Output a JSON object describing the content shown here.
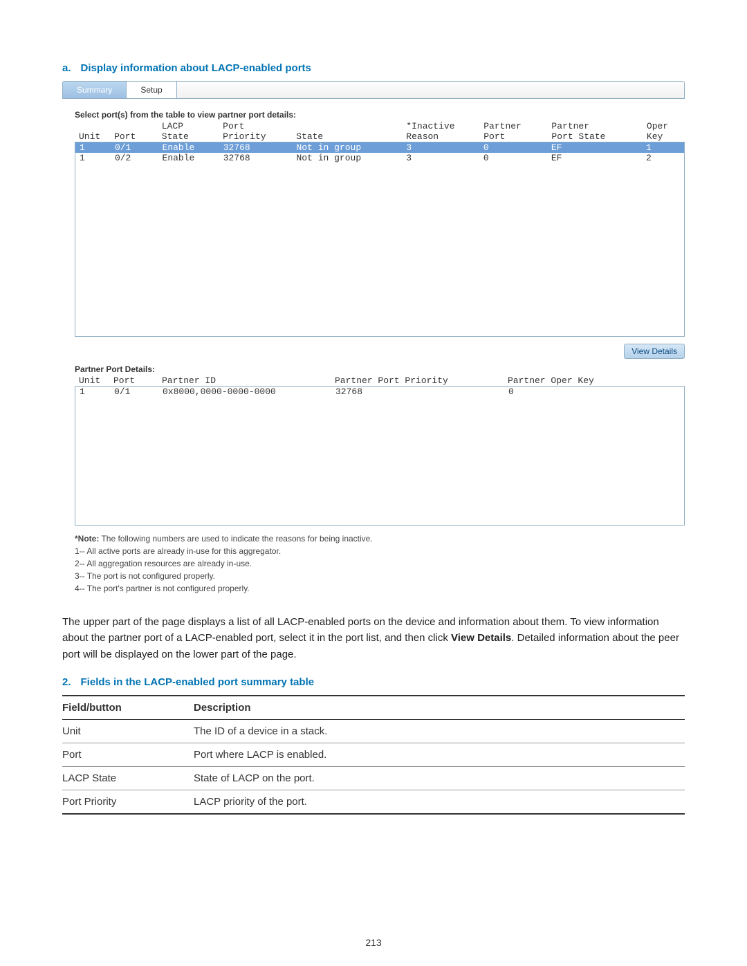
{
  "heading_a": {
    "label": "a.",
    "text": "Display information about LACP-enabled ports"
  },
  "tabs": {
    "summary": "Summary",
    "setup": "Setup"
  },
  "instruction": "Select port(s) from the table to view partner port details:",
  "main_headers": {
    "unit": "Unit",
    "port": "Port",
    "lacp_top": "LACP",
    "lacp_bot": "State",
    "prio_top": "Port",
    "prio_bot": "Priority",
    "state": "State",
    "reason_top": "*Inactive",
    "reason_bot": "Reason",
    "pport_top": "Partner",
    "pport_bot": "Port",
    "pstate_top": "Partner",
    "pstate_bot": "Port State",
    "key_top": "Oper",
    "key_bot": "Key"
  },
  "main_rows": [
    {
      "unit": "1",
      "port": "0/1",
      "lacp": "Enable",
      "prio": "32768",
      "state": "Not in group",
      "reason": "3",
      "pport": "0",
      "pstate": "EF",
      "key": "1",
      "selected": true
    },
    {
      "unit": "1",
      "port": "0/2",
      "lacp": "Enable",
      "prio": "32768",
      "state": "Not in group",
      "reason": "3",
      "pport": "0",
      "pstate": "EF",
      "key": "2",
      "selected": false
    }
  ],
  "view_details": "View Details",
  "partner_title": "Partner Port Details:",
  "partner_headers": {
    "unit": "Unit",
    "port": "Port",
    "pid": "Partner ID",
    "ppr": "Partner Port Priority",
    "pok": "Partner Oper Key"
  },
  "partner_rows": [
    {
      "unit": "1",
      "port": "0/1",
      "pid": "0x8000,0000-0000-0000",
      "ppr": "32768",
      "pok": "0"
    }
  ],
  "notes": {
    "head_label": "*Note:",
    "head_text": " The following numbers are used to indicate the reasons for being inactive.",
    "l1": "1-- All active ports are already in-use for this aggregator.",
    "l2": "2-- All aggregation resources are already in-use.",
    "l3": "3-- The port is not configured properly.",
    "l4": "4-- The port's partner is not configured properly."
  },
  "body": {
    "p1a": "The upper part of the page displays a list of all LACP-enabled ports on the device and information about them. To view information about the partner port of a LACP-enabled port, select it in the port list, and then click ",
    "vd": "View Details",
    "p1b": ". Detailed information about the peer port will be displayed on the lower part of the page."
  },
  "heading_2": {
    "label": "2.",
    "text": "Fields in the LACP-enabled port summary table"
  },
  "fields_header": {
    "field": "Field/button",
    "desc": "Description"
  },
  "fields_rows": [
    {
      "field": "Unit",
      "desc": "The ID of a device in a stack."
    },
    {
      "field": "Port",
      "desc": "Port where LACP is enabled."
    },
    {
      "field": "LACP State",
      "desc": "State of LACP on the port."
    },
    {
      "field": "Port Priority",
      "desc": "LACP priority of the port."
    }
  ],
  "page_number": "213"
}
